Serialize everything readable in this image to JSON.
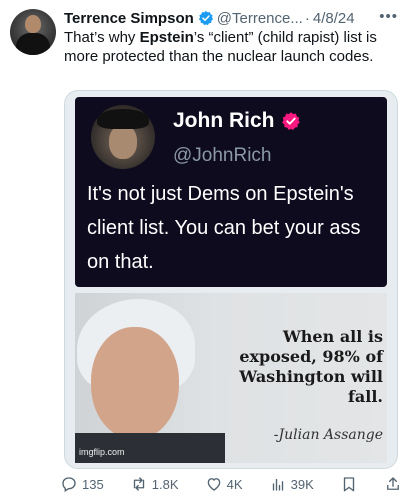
{
  "author": {
    "name": "Terrence Simpson",
    "handle": "@Terrence...",
    "separator": "·",
    "date": "4/8/24",
    "more_icon": "more-icon",
    "verified_color": "#1d9bf0"
  },
  "tweet": {
    "text_before": "That’s why ",
    "text_bold": "Epstein",
    "text_after": "’s “client” (child rapist) list is more protected than the nuclear launch codes."
  },
  "quoted_post": {
    "name": "John Rich",
    "handle": "@JohnRich",
    "text": "It's not just Dems on Epstein's client list. You can bet your ass on that.",
    "badge_color": "#f91880"
  },
  "image": {
    "line1": "When all is",
    "line2": "exposed, 98% of",
    "line3": "Washington will fall.",
    "signature": "-Julian Assange",
    "watermark": "imgflip.com"
  },
  "actions": {
    "replies": "135",
    "reposts": "1.8K",
    "likes": "4K",
    "views": "39K"
  }
}
